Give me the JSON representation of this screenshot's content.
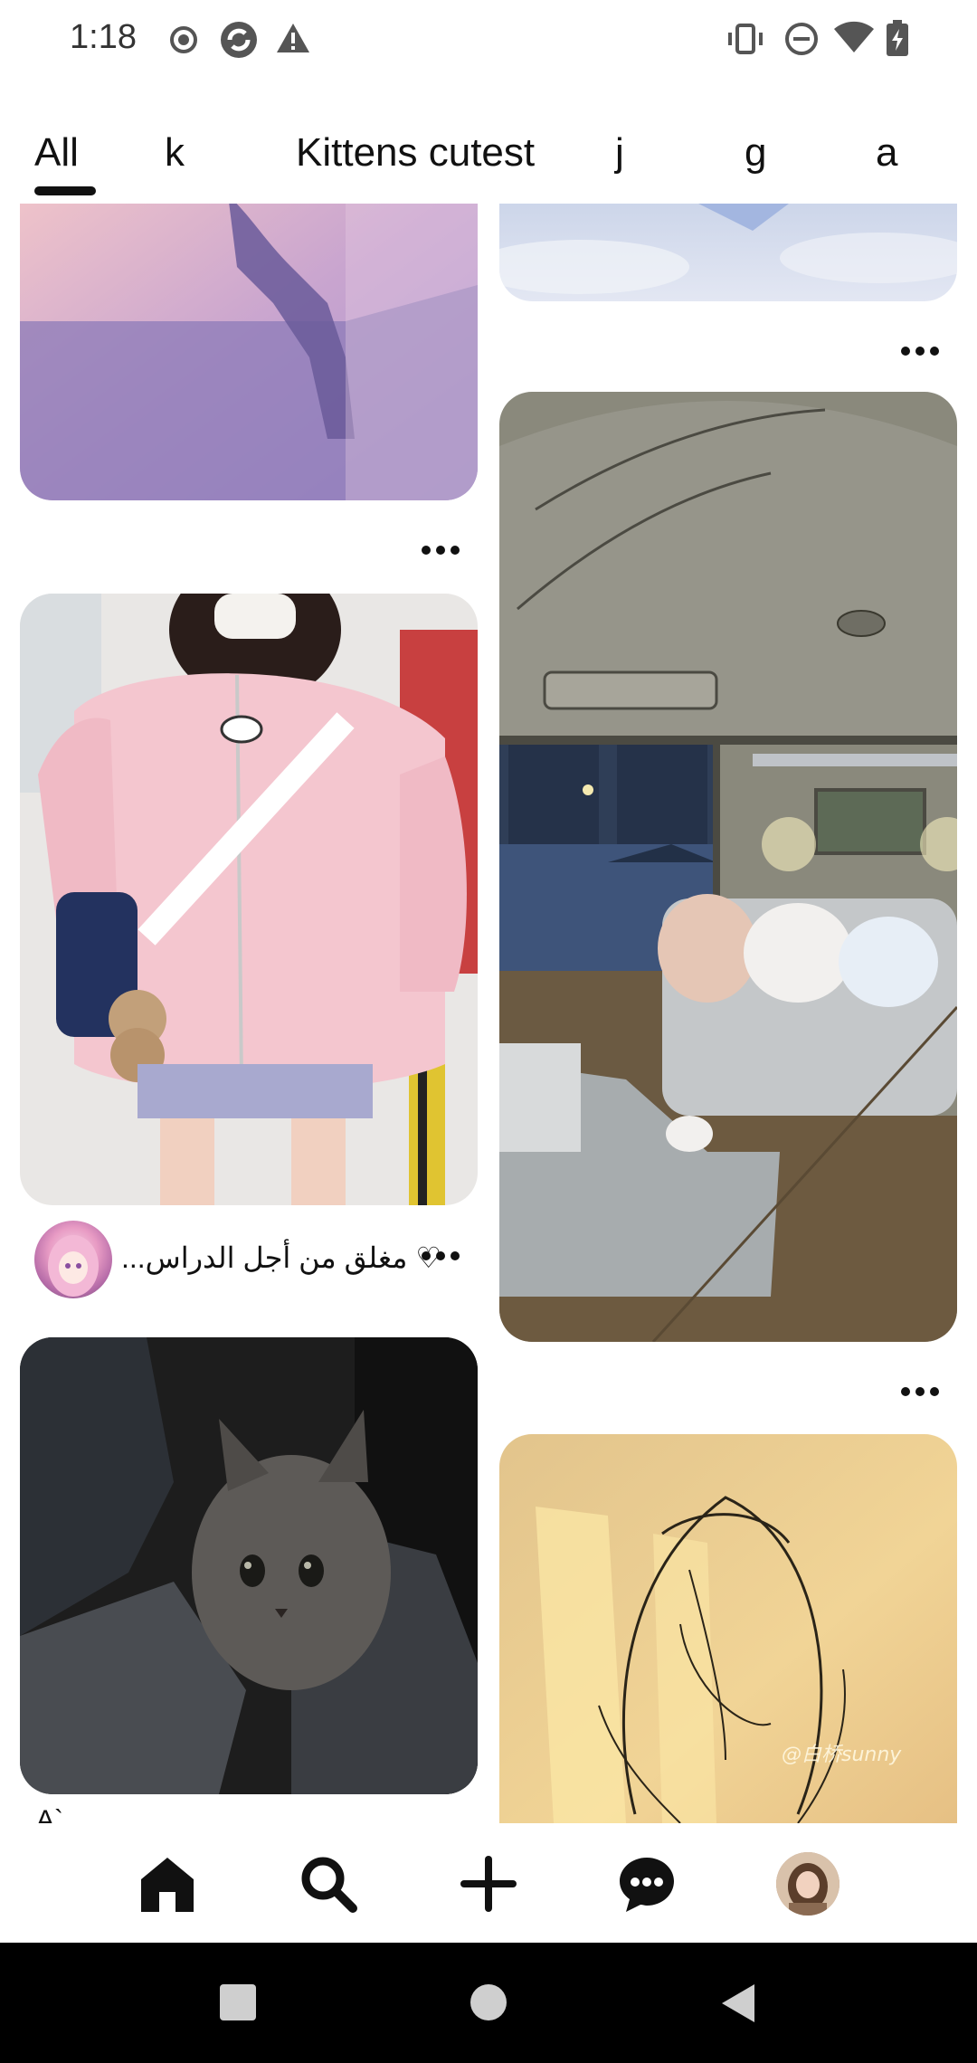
{
  "status_bar": {
    "time": "1:18",
    "icons": [
      "record-icon",
      "sync-icon",
      "warning-icon",
      "vibrate-icon",
      "dnd-icon",
      "wifi-icon",
      "battery-charging-icon"
    ]
  },
  "tabs": [
    {
      "label": "All",
      "selected": true
    },
    {
      "label": "k",
      "selected": false
    },
    {
      "label": "Kittens cutest",
      "selected": false
    },
    {
      "label": "j",
      "selected": false
    },
    {
      "label": "g",
      "selected": false
    },
    {
      "label": "a",
      "selected": false
    }
  ],
  "pins": {
    "pin2_title": "♡ مغلق من أجل الدراس...",
    "partial_caption": "A`"
  },
  "image_texts": {
    "watermark_drawing": "@白桥sunny"
  },
  "bottom_nav": [
    "home-icon",
    "search-icon",
    "create-icon",
    "messages-icon",
    "profile-avatar"
  ],
  "colors": {
    "accent": "#111111",
    "nav_bg": "#000000"
  }
}
